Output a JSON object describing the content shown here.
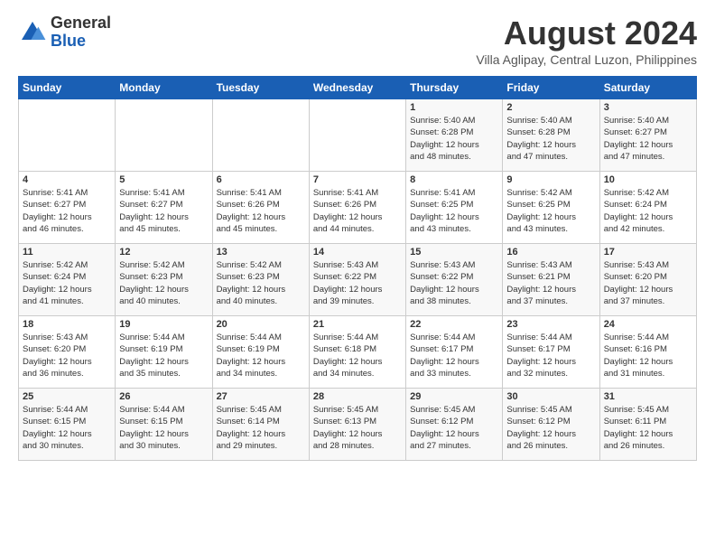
{
  "logo": {
    "line1": "General",
    "line2": "Blue"
  },
  "title": "August 2024",
  "subtitle": "Villa Aglipay, Central Luzon, Philippines",
  "days_of_week": [
    "Sunday",
    "Monday",
    "Tuesday",
    "Wednesday",
    "Thursday",
    "Friday",
    "Saturday"
  ],
  "weeks": [
    [
      {
        "day": "",
        "info": ""
      },
      {
        "day": "",
        "info": ""
      },
      {
        "day": "",
        "info": ""
      },
      {
        "day": "",
        "info": ""
      },
      {
        "day": "1",
        "info": "Sunrise: 5:40 AM\nSunset: 6:28 PM\nDaylight: 12 hours\nand 48 minutes."
      },
      {
        "day": "2",
        "info": "Sunrise: 5:40 AM\nSunset: 6:28 PM\nDaylight: 12 hours\nand 47 minutes."
      },
      {
        "day": "3",
        "info": "Sunrise: 5:40 AM\nSunset: 6:27 PM\nDaylight: 12 hours\nand 47 minutes."
      }
    ],
    [
      {
        "day": "4",
        "info": "Sunrise: 5:41 AM\nSunset: 6:27 PM\nDaylight: 12 hours\nand 46 minutes."
      },
      {
        "day": "5",
        "info": "Sunrise: 5:41 AM\nSunset: 6:27 PM\nDaylight: 12 hours\nand 45 minutes."
      },
      {
        "day": "6",
        "info": "Sunrise: 5:41 AM\nSunset: 6:26 PM\nDaylight: 12 hours\nand 45 minutes."
      },
      {
        "day": "7",
        "info": "Sunrise: 5:41 AM\nSunset: 6:26 PM\nDaylight: 12 hours\nand 44 minutes."
      },
      {
        "day": "8",
        "info": "Sunrise: 5:41 AM\nSunset: 6:25 PM\nDaylight: 12 hours\nand 43 minutes."
      },
      {
        "day": "9",
        "info": "Sunrise: 5:42 AM\nSunset: 6:25 PM\nDaylight: 12 hours\nand 43 minutes."
      },
      {
        "day": "10",
        "info": "Sunrise: 5:42 AM\nSunset: 6:24 PM\nDaylight: 12 hours\nand 42 minutes."
      }
    ],
    [
      {
        "day": "11",
        "info": "Sunrise: 5:42 AM\nSunset: 6:24 PM\nDaylight: 12 hours\nand 41 minutes."
      },
      {
        "day": "12",
        "info": "Sunrise: 5:42 AM\nSunset: 6:23 PM\nDaylight: 12 hours\nand 40 minutes."
      },
      {
        "day": "13",
        "info": "Sunrise: 5:42 AM\nSunset: 6:23 PM\nDaylight: 12 hours\nand 40 minutes."
      },
      {
        "day": "14",
        "info": "Sunrise: 5:43 AM\nSunset: 6:22 PM\nDaylight: 12 hours\nand 39 minutes."
      },
      {
        "day": "15",
        "info": "Sunrise: 5:43 AM\nSunset: 6:22 PM\nDaylight: 12 hours\nand 38 minutes."
      },
      {
        "day": "16",
        "info": "Sunrise: 5:43 AM\nSunset: 6:21 PM\nDaylight: 12 hours\nand 37 minutes."
      },
      {
        "day": "17",
        "info": "Sunrise: 5:43 AM\nSunset: 6:20 PM\nDaylight: 12 hours\nand 37 minutes."
      }
    ],
    [
      {
        "day": "18",
        "info": "Sunrise: 5:43 AM\nSunset: 6:20 PM\nDaylight: 12 hours\nand 36 minutes."
      },
      {
        "day": "19",
        "info": "Sunrise: 5:44 AM\nSunset: 6:19 PM\nDaylight: 12 hours\nand 35 minutes."
      },
      {
        "day": "20",
        "info": "Sunrise: 5:44 AM\nSunset: 6:19 PM\nDaylight: 12 hours\nand 34 minutes."
      },
      {
        "day": "21",
        "info": "Sunrise: 5:44 AM\nSunset: 6:18 PM\nDaylight: 12 hours\nand 34 minutes."
      },
      {
        "day": "22",
        "info": "Sunrise: 5:44 AM\nSunset: 6:17 PM\nDaylight: 12 hours\nand 33 minutes."
      },
      {
        "day": "23",
        "info": "Sunrise: 5:44 AM\nSunset: 6:17 PM\nDaylight: 12 hours\nand 32 minutes."
      },
      {
        "day": "24",
        "info": "Sunrise: 5:44 AM\nSunset: 6:16 PM\nDaylight: 12 hours\nand 31 minutes."
      }
    ],
    [
      {
        "day": "25",
        "info": "Sunrise: 5:44 AM\nSunset: 6:15 PM\nDaylight: 12 hours\nand 30 minutes."
      },
      {
        "day": "26",
        "info": "Sunrise: 5:44 AM\nSunset: 6:15 PM\nDaylight: 12 hours\nand 30 minutes."
      },
      {
        "day": "27",
        "info": "Sunrise: 5:45 AM\nSunset: 6:14 PM\nDaylight: 12 hours\nand 29 minutes."
      },
      {
        "day": "28",
        "info": "Sunrise: 5:45 AM\nSunset: 6:13 PM\nDaylight: 12 hours\nand 28 minutes."
      },
      {
        "day": "29",
        "info": "Sunrise: 5:45 AM\nSunset: 6:12 PM\nDaylight: 12 hours\nand 27 minutes."
      },
      {
        "day": "30",
        "info": "Sunrise: 5:45 AM\nSunset: 6:12 PM\nDaylight: 12 hours\nand 26 minutes."
      },
      {
        "day": "31",
        "info": "Sunrise: 5:45 AM\nSunset: 6:11 PM\nDaylight: 12 hours\nand 26 minutes."
      }
    ]
  ]
}
